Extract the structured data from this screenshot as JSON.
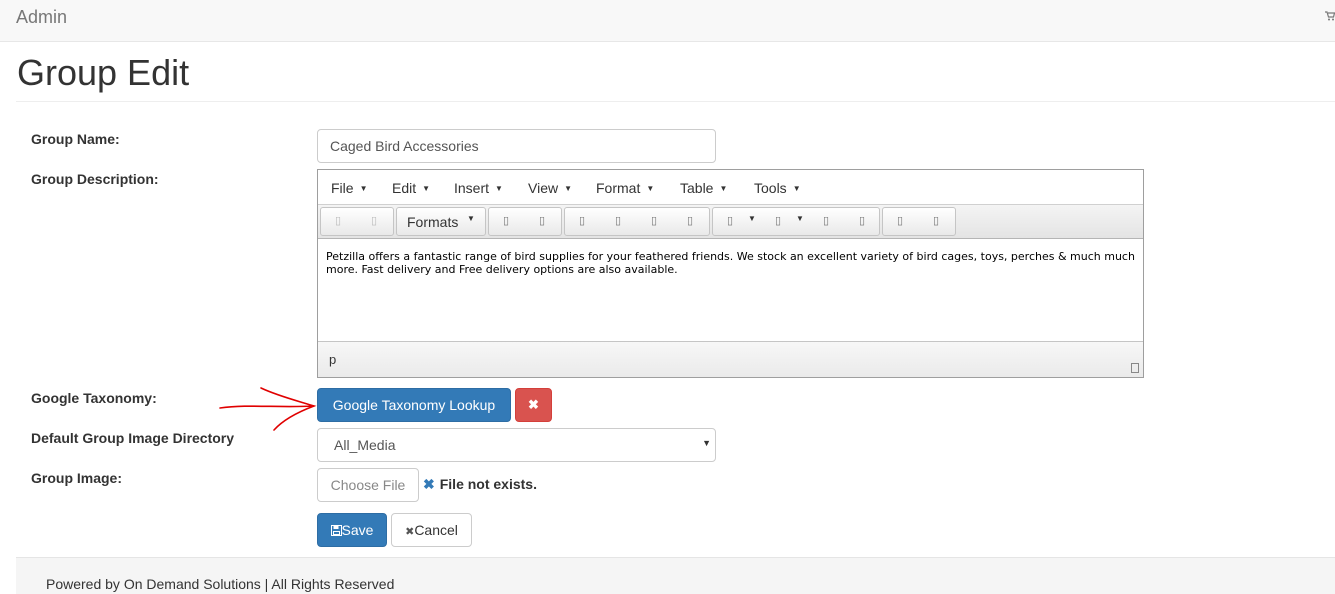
{
  "navbar": {
    "brand": "Admin",
    "cart_icon": "cart-icon"
  },
  "page": {
    "title": "Group Edit"
  },
  "form": {
    "group_name": {
      "label": "Group Name:",
      "value": "Caged Bird Accessories"
    },
    "group_description": {
      "label": "Group Description:",
      "menu": [
        "File",
        "Edit",
        "Insert",
        "View",
        "Format",
        "Table",
        "Tools"
      ],
      "formats_label": "Formats",
      "content": "Petzilla offers a fantastic range of bird supplies for your feathered friends. We stock an excellent  variety of bird cages, toys, perches & much much more. Fast delivery and Free delivery options are also available.",
      "path": "p",
      "toolbar_icons": [
        "undo-icon",
        "redo-icon",
        "bold-icon",
        "italic-icon",
        "align-left-icon",
        "align-center-icon",
        "align-right-icon",
        "align-justify-icon",
        "bullet-list-icon",
        "numbered-list-icon",
        "outdent-icon",
        "indent-icon",
        "link-icon",
        "image-icon"
      ]
    },
    "google_taxonomy": {
      "label": "Google Taxonomy:",
      "lookup_button": "Google Taxonomy Lookup",
      "clear_button": "✖"
    },
    "image_directory": {
      "label": "Default Group Image Directory",
      "selected": "All_Media"
    },
    "group_image": {
      "label": "Group Image:",
      "choose_button": "Choose File",
      "status": "File not exists."
    },
    "save_button": "Save",
    "cancel_button": "Cancel"
  },
  "footer": {
    "text": "Powered by On Demand Solutions | All Rights Reserved"
  },
  "colors": {
    "primary": "#337ab7",
    "danger": "#d9534f",
    "annotation": "#e00000"
  }
}
